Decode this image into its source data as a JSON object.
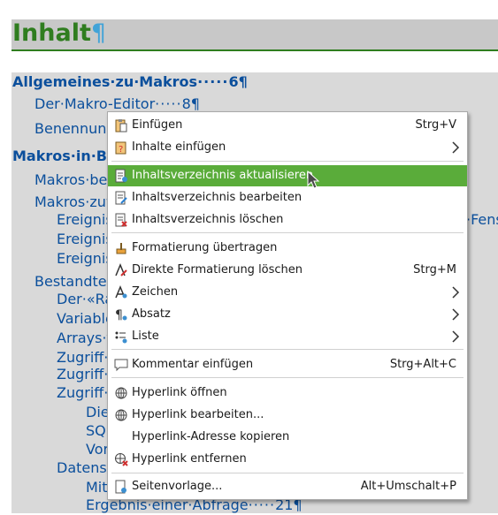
{
  "document": {
    "title": "Inhalt",
    "title_mark": "¶",
    "toc": [
      {
        "text": "Allgemeines·zu·Makros",
        "dots": "·····",
        "page": "6¶",
        "level": 1
      },
      {
        "text": "Der·Makro-Editor",
        "dots": "·····",
        "page": "8¶",
        "level": 2
      },
      {
        "text": "Benennung",
        "dots": "",
        "page": "",
        "level": 2
      },
      {
        "text": "Makros·in·Ba",
        "dots": "",
        "page": "",
        "level": 1
      },
      {
        "text": "Makros·bei",
        "dots": "",
        "page": "",
        "level": 2
      },
      {
        "text": "Makros·zuw",
        "dots": "",
        "page": "",
        "level": 2
      },
      {
        "text": "Ereignis",
        "dots": "",
        "page": "",
        "level": 3
      },
      {
        "text": "Ereignis",
        "dots": "",
        "page": "",
        "level": 3
      },
      {
        "text": "Ereignis",
        "dots": "",
        "page": "",
        "level": 3
      },
      {
        "text": "Bestandtei",
        "dots": "",
        "page": "",
        "level": 2
      },
      {
        "text": "Der·«Ra",
        "dots": "",
        "page": "",
        "level": 3
      },
      {
        "text": "Variable",
        "dots": "",
        "page": "",
        "level": 3
      },
      {
        "text": "Arrays·f",
        "dots": "",
        "page": "",
        "level": 3
      },
      {
        "text": "Zugriff·",
        "dots": "",
        "page": "",
        "level": 3
      },
      {
        "text": "Zugriff·",
        "dots": "",
        "page": "",
        "level": 3
      },
      {
        "text": "Zugriff·",
        "dots": "",
        "page": "",
        "level": 3
      },
      {
        "text": "Die",
        "dots": "",
        "page": "",
        "level": 4
      },
      {
        "text": "SQ",
        "dots": "",
        "page": "",
        "level": 4
      },
      {
        "text": "Vor",
        "dots": "",
        "page": "",
        "level": 4
      },
      {
        "text": "Datensä",
        "dots": "",
        "page": "",
        "level": 3
      },
      {
        "text": "Mit",
        "dots": "",
        "page": "",
        "level": 4
      },
      {
        "text": "Ergebnis·einer·Abfrage",
        "dots": "·····",
        "page": "21¶",
        "level": 4
      }
    ],
    "overflow_right_text": "·Fens"
  },
  "context_menu": {
    "items": [
      {
        "label": "Einfügen",
        "shortcut": "Strg+V",
        "icon": "clipboard-paste-icon"
      },
      {
        "label": "Inhalte einfügen",
        "submenu": true,
        "icon": "paste-special-icon"
      },
      {
        "label": "Inhaltsverzeichnis aktualisieren",
        "highlighted": true,
        "icon": "toc-update-icon"
      },
      {
        "label": "Inhaltsverzeichnis bearbeiten",
        "icon": "toc-edit-icon"
      },
      {
        "label": "Inhaltsverzeichnis löschen",
        "icon": "toc-delete-icon"
      },
      {
        "label": "Formatierung übertragen",
        "icon": "clone-formatting-icon"
      },
      {
        "label": "Direkte Formatierung löschen",
        "shortcut": "Strg+M",
        "icon": "clear-formatting-icon"
      },
      {
        "label": "Zeichen",
        "submenu": true,
        "icon": "character-icon"
      },
      {
        "label": "Absatz",
        "submenu": true,
        "icon": "paragraph-icon"
      },
      {
        "label": "Liste",
        "submenu": true,
        "icon": "list-icon"
      },
      {
        "label": "Kommentar einfügen",
        "shortcut": "Strg+Alt+C",
        "icon": "comment-icon"
      },
      {
        "label": "Hyperlink öffnen",
        "icon": "hyperlink-open-icon"
      },
      {
        "label": "Hyperlink bearbeiten...",
        "icon": "hyperlink-edit-icon"
      },
      {
        "label": "Hyperlink-Adresse kopieren",
        "icon": ""
      },
      {
        "label": "Hyperlink entfernen",
        "icon": "hyperlink-remove-icon"
      },
      {
        "label": "Seitenvorlage...",
        "shortcut": "Alt+Umschalt+P",
        "icon": "page-style-icon"
      }
    ]
  },
  "colors": {
    "heading_green": "#2f7d1f",
    "toc_blue": "#0b4f9c",
    "highlight_green": "#5aac3a"
  }
}
